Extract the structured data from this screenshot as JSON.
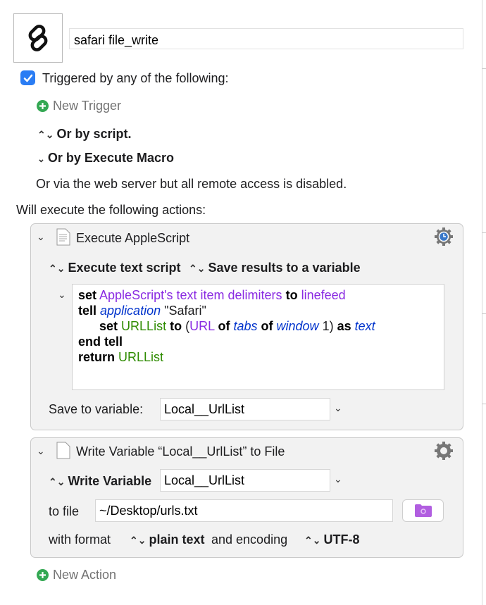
{
  "macro": {
    "icon": "link-icon",
    "name": "safari file_write"
  },
  "triggers": {
    "checked": true,
    "label": "Triggered by any of the following:",
    "new_trigger": "New Trigger",
    "by_script": "Or by script.",
    "by_execute_macro": "Or by Execute Macro",
    "web_server": "Or via the web server but all remote access is disabled."
  },
  "actions_header": "Will execute the following actions:",
  "action1": {
    "title": "Execute AppleScript",
    "mode": "Execute text script",
    "result": "Save results to a variable",
    "script_lines": [
      [
        {
          "t": "set",
          "c": "k"
        },
        {
          "t": " "
        },
        {
          "t": "AppleScript's text item delimiters",
          "c": "p"
        },
        {
          "t": " "
        },
        {
          "t": "to",
          "c": "k"
        },
        {
          "t": " "
        },
        {
          "t": "linefeed",
          "c": "p"
        }
      ],
      [
        {
          "t": "tell",
          "c": "k"
        },
        {
          "t": " "
        },
        {
          "t": "application",
          "c": "ib"
        },
        {
          "t": " \"Safari\""
        }
      ],
      [
        {
          "t": "      "
        },
        {
          "t": "set",
          "c": "k"
        },
        {
          "t": " "
        },
        {
          "t": "URLList",
          "c": "g"
        },
        {
          "t": " "
        },
        {
          "t": "to",
          "c": "k"
        },
        {
          "t": " ("
        },
        {
          "t": "URL",
          "c": "p"
        },
        {
          "t": " "
        },
        {
          "t": "of",
          "c": "k"
        },
        {
          "t": " "
        },
        {
          "t": "tabs",
          "c": "ib"
        },
        {
          "t": " "
        },
        {
          "t": "of",
          "c": "k"
        },
        {
          "t": " "
        },
        {
          "t": "window",
          "c": "ib"
        },
        {
          "t": " 1) "
        },
        {
          "t": "as",
          "c": "k"
        },
        {
          "t": " "
        },
        {
          "t": "text",
          "c": "ib"
        }
      ],
      [
        {
          "t": "end tell",
          "c": "k"
        }
      ],
      [
        {
          "t": "return",
          "c": "k"
        },
        {
          "t": " "
        },
        {
          "t": "URLList",
          "c": "g"
        }
      ]
    ],
    "save_label": "Save to variable:",
    "save_value": "Local__UrlList"
  },
  "action2": {
    "title": "Write Variable “Local__UrlList” to File",
    "write_label": "Write Variable",
    "write_value": "Local__UrlList",
    "to_file_label": "to file",
    "to_file_value": "~/Desktop/urls.txt",
    "with_format_label": "with format",
    "format_value": "plain text",
    "encoding_label": "and encoding",
    "encoding_value": "UTF-8"
  },
  "new_action": "New Action",
  "colors": {
    "checkbox": "#2a7df4",
    "add": "#34a853",
    "keyword": "#000000",
    "property": "#8a2be2",
    "class": "#0033cc",
    "variable": "#2e8b00",
    "folder": "#b15ee0"
  }
}
